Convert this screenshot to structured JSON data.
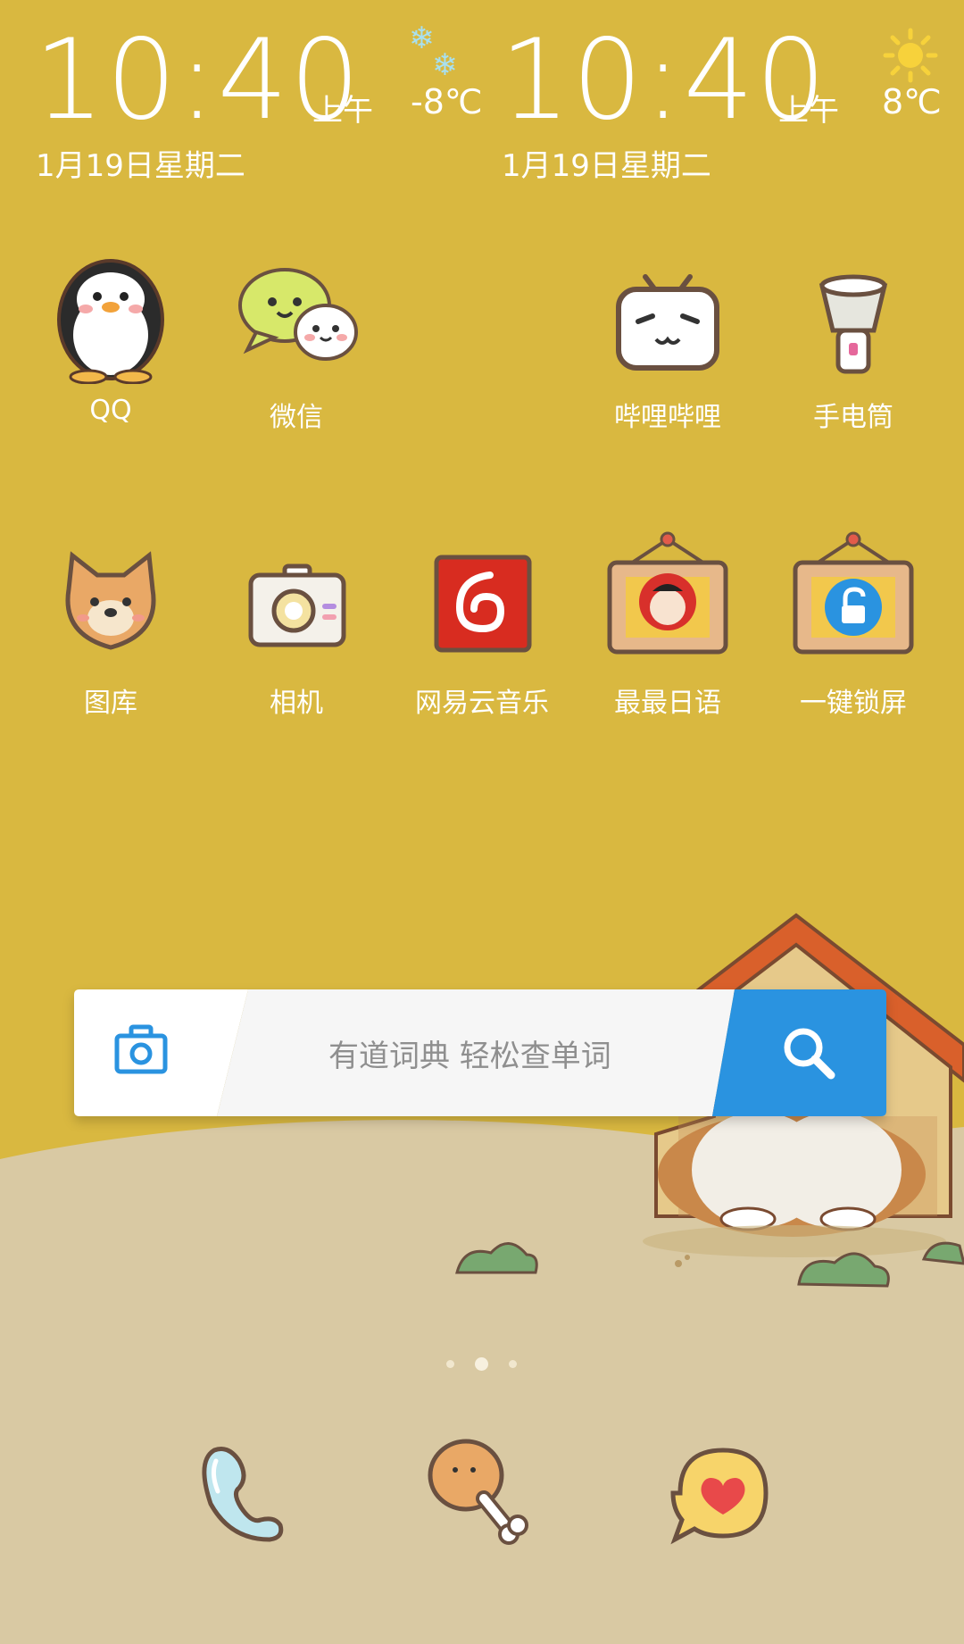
{
  "clocks": [
    {
      "time": "10:40",
      "ampm": "上午",
      "date": "1月19日星期二",
      "weather_icon": "snowflake-icon",
      "temperature": "-8℃"
    },
    {
      "time": "10:40",
      "ampm": "上午",
      "date": "1月19日星期二",
      "weather_icon": "sun-icon",
      "temperature": "8℃"
    }
  ],
  "apps_row1": [
    {
      "label": "QQ",
      "icon": "penguin-icon"
    },
    {
      "label": "微信",
      "icon": "chat-bubbles-icon"
    },
    {
      "label": "哔哩哔哩",
      "icon": "tv-face-icon"
    },
    {
      "label": "手电筒",
      "icon": "flashlight-icon"
    }
  ],
  "apps_row2": [
    {
      "label": "图库",
      "icon": "dog-face-icon"
    },
    {
      "label": "相机",
      "icon": "camera-icon"
    },
    {
      "label": "网易云音乐",
      "icon": "netease-music-icon"
    },
    {
      "label": "最最日语",
      "icon": "sumo-frame-icon"
    },
    {
      "label": "一键锁屏",
      "icon": "lock-frame-icon"
    }
  ],
  "search_widget": {
    "placeholder": "有道词典 轻松查单词",
    "camera_icon": "camera-icon",
    "search_icon": "search-icon",
    "accent": "#2A93E0"
  },
  "page_indicator": {
    "count": 3,
    "current": 2
  },
  "dock": [
    {
      "icon": "phone-icon"
    },
    {
      "icon": "drumstick-icon"
    },
    {
      "icon": "heart-message-icon"
    }
  ],
  "colors": {
    "background": "#D9B840",
    "ground": "#D9C9A3",
    "text": "#FFFFFF"
  }
}
